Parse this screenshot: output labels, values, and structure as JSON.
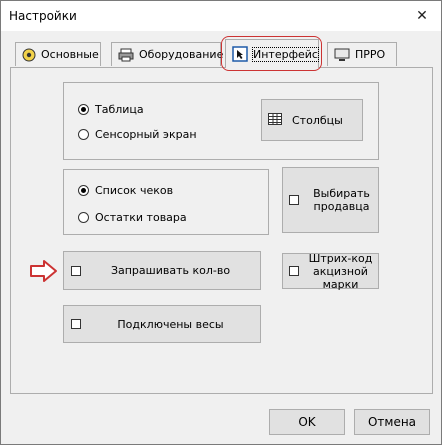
{
  "window": {
    "title": "Настройки",
    "close_glyph": "✕"
  },
  "tabs": [
    {
      "label": "Основные",
      "icon": "settings-circle-icon"
    },
    {
      "label": "Оборудование",
      "icon": "printer-icon"
    },
    {
      "label": "Интерфейс",
      "icon": "cursor-window-icon",
      "active": true
    },
    {
      "label": "ПРРО",
      "icon": "monitor-icon"
    }
  ],
  "view_group": {
    "options": [
      {
        "label": "Таблица",
        "selected": true
      },
      {
        "label": "Сенсорный экран",
        "selected": false
      }
    ],
    "columns_button": "Столбцы"
  },
  "list_group": {
    "options": [
      {
        "label": "Список чеков",
        "selected": true
      },
      {
        "label": "Остатки товара",
        "selected": false
      }
    ]
  },
  "checkboxes": {
    "choose_seller": "Выбирать продавца",
    "ask_quantity": "Запрашивать кол-во",
    "excise_barcode": "Штрих-код акцизной марки",
    "scales_connected": "Подключены весы"
  },
  "footer": {
    "ok_label": "OK",
    "cancel_label": "Отмена"
  },
  "colors": {
    "annotation": "#cc3333",
    "accent_icon": "#1e5aa8"
  }
}
